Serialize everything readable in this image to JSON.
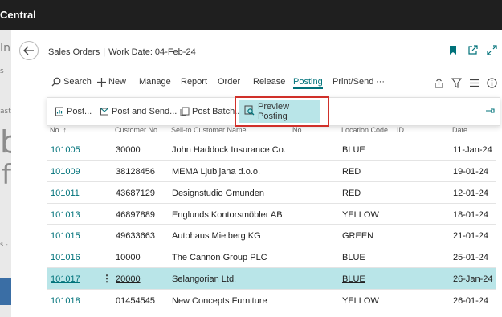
{
  "app": {
    "title": "Central"
  },
  "backdrop": {
    "g1": "In",
    "g2": "s",
    "g3": "ast",
    "g4": "b",
    "g5": "f",
    "g6": "s -"
  },
  "header": {
    "breadcrumb_page": "Sales Orders",
    "breadcrumb_sep": "|",
    "work_date": "Work Date: 04-Feb-24",
    "icons": [
      "back-arrow-icon",
      "bookmark-icon",
      "open-new-window-icon",
      "expand-icon"
    ]
  },
  "actions": [
    {
      "label": "Search",
      "icon": "search-icon"
    },
    {
      "label": "New",
      "icon": "plus-icon"
    },
    {
      "label": "Manage"
    },
    {
      "label": "Report"
    },
    {
      "label": "Order"
    },
    {
      "label": "Release"
    },
    {
      "label": "Posting",
      "active": true
    },
    {
      "label": "Print/Send"
    },
    {
      "label": "···"
    }
  ],
  "action_icons": [
    "share-icon",
    "filter-icon",
    "list-view-icon",
    "info-icon"
  ],
  "posting_menu": {
    "post": "Post...",
    "post_and_send": "Post and Send...",
    "post_batch": "Post Batch...",
    "preview_posting": "Preview Posting"
  },
  "colors": {
    "accent": "#00727a",
    "highlight": "#b9e5e8",
    "callout": "#d0302a",
    "topbar": "#1f1f1f"
  },
  "table": {
    "columns": {
      "no": "No. ↑",
      "customer_no": "Customer No.",
      "customer_name": "Sell-to Customer Name",
      "no2": "No.",
      "location": "Location Code",
      "id": "ID",
      "date": "Date"
    },
    "rows": [
      {
        "no": "101005",
        "customer_no": "30000",
        "name": "John Haddock Insurance Co.",
        "location": "BLUE",
        "date": "11-Jan-24"
      },
      {
        "no": "101009",
        "customer_no": "38128456",
        "name": "MEMA Ljubljana d.o.o.",
        "location": "RED",
        "date": "19-01-24"
      },
      {
        "no": "101011",
        "customer_no": "43687129",
        "name": "Designstudio Gmunden",
        "location": "RED",
        "date": "12-01-24"
      },
      {
        "no": "101013",
        "customer_no": "46897889",
        "name": "Englunds Kontorsmöbler AB",
        "location": "YELLOW",
        "date": "18-01-24"
      },
      {
        "no": "101015",
        "customer_no": "49633663",
        "name": "Autohaus Mielberg KG",
        "location": "GREEN",
        "date": "21-01-24"
      },
      {
        "no": "101016",
        "customer_no": "10000",
        "name": "The Cannon Group PLC",
        "location": "BLUE",
        "date": "25-01-24"
      },
      {
        "no": "101017",
        "customer_no": "20000",
        "name": "Selangorian Ltd.",
        "location": "BLUE",
        "date": "26-Jan-24",
        "selected": true,
        "row_menu": "⋮"
      },
      {
        "no": "101018",
        "customer_no": "01454545",
        "name": "New Concepts Furniture",
        "location": "YELLOW",
        "date": "26-01-24"
      }
    ]
  }
}
